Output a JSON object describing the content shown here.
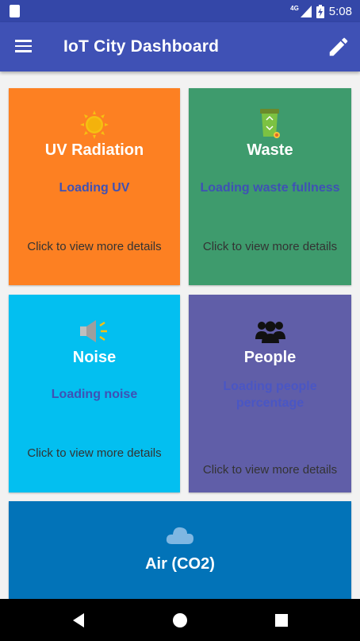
{
  "status_bar": {
    "time": "5:08",
    "network_label": "4G",
    "icons": [
      "sd-card-icon",
      "network-signal-icon",
      "battery-charging-icon"
    ]
  },
  "app_bar": {
    "title": "IoT City Dashboard",
    "menu_icon": "hamburger-menu-icon",
    "edit_icon": "pencil-icon"
  },
  "tiles": [
    {
      "id": "uv",
      "icon": "sun-icon",
      "title": "UV Radiation",
      "status": "Loading UV",
      "details": "Click to view more details",
      "color": "#fd8022"
    },
    {
      "id": "waste",
      "icon": "recycle-bin-icon",
      "title": "Waste",
      "status": "Loading waste fullness",
      "details": "Click to view more details",
      "color": "#3e9b6d"
    },
    {
      "id": "noise",
      "icon": "speaker-icon",
      "title": "Noise",
      "status": "Loading noise",
      "details": "Click to view more details",
      "color": "#03bff0"
    },
    {
      "id": "people",
      "icon": "people-icon",
      "title": "People",
      "status": "Loading people percentage",
      "details": "Click to view more details",
      "color": "#605ea8"
    },
    {
      "id": "air",
      "icon": "cloud-icon",
      "title": "Air (CO2)",
      "color": "#0273b8"
    }
  ],
  "colors": {
    "primary": "#3f51b5",
    "primary_dark": "#3447a8",
    "status_text": "#3f51b5"
  },
  "nav_bar": {
    "icons": [
      "back-triangle-icon",
      "home-circle-icon",
      "recents-square-icon"
    ]
  }
}
